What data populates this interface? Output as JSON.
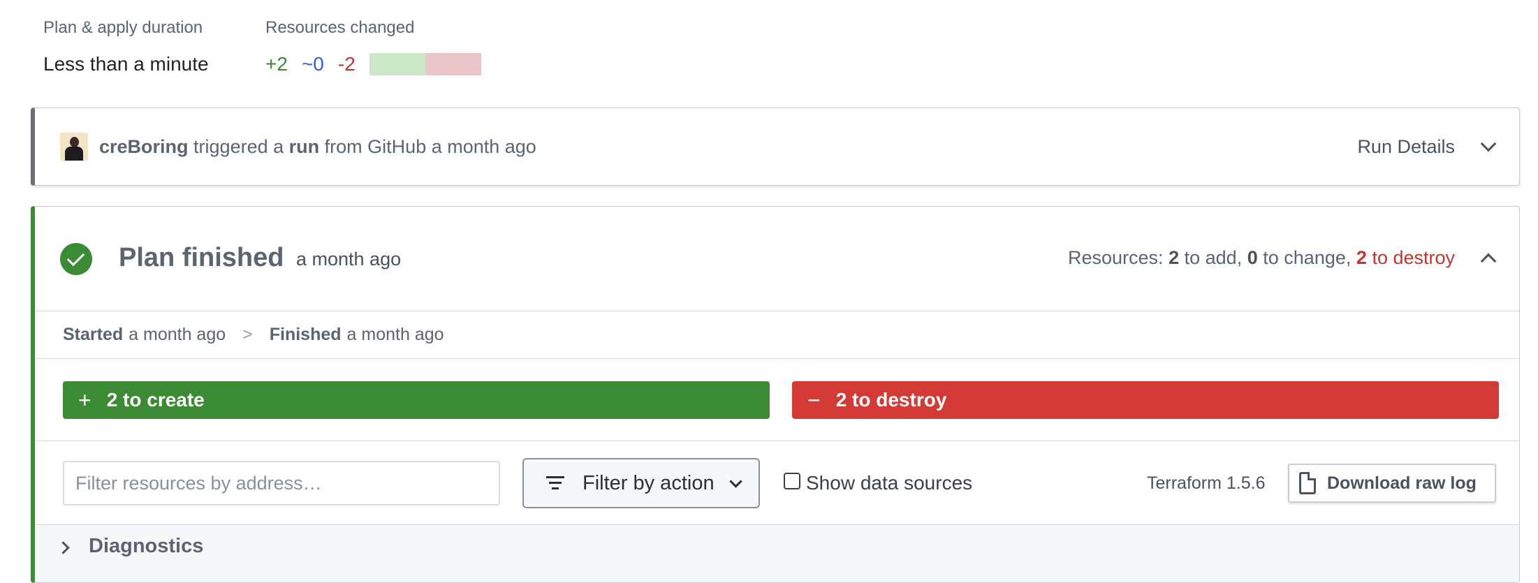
{
  "summary": {
    "duration_label": "Plan & apply duration",
    "duration_value": "Less than a minute",
    "resources_label": "Resources changed",
    "added": "+2",
    "changed": "~0",
    "destroyed": "-2"
  },
  "trigger": {
    "user": "creBoring",
    "text_triggered": "triggered a",
    "run_word": "run",
    "from_text": "from GitHub a month ago",
    "details_label": "Run Details"
  },
  "plan": {
    "title": "Plan finished",
    "time": "a month ago",
    "res_prefix": "Resources:",
    "add_count": "2",
    "add_text": "to add,",
    "change_count": "0",
    "change_text": "to change,",
    "destroy_count": "2",
    "destroy_text": "to destroy",
    "started_label": "Started",
    "started_time": "a month ago",
    "separator": ">",
    "finished_label": "Finished",
    "finished_time": "a month ago",
    "create_symbol": "+",
    "create_label": "2 to create",
    "destroy_symbol": "−",
    "destroy_label": "2 to destroy"
  },
  "toolbar": {
    "filter_placeholder": "Filter resources by address…",
    "filter_action_label": "Filter by action",
    "show_data_sources_label": "Show data sources",
    "terraform_version": "Terraform 1.5.6",
    "download_label": "Download raw log"
  },
  "diagnostics": {
    "label": "Diagnostics"
  },
  "colors": {
    "success": "#3b8b35",
    "danger": "#d33a35",
    "change": "#2f63d6"
  }
}
